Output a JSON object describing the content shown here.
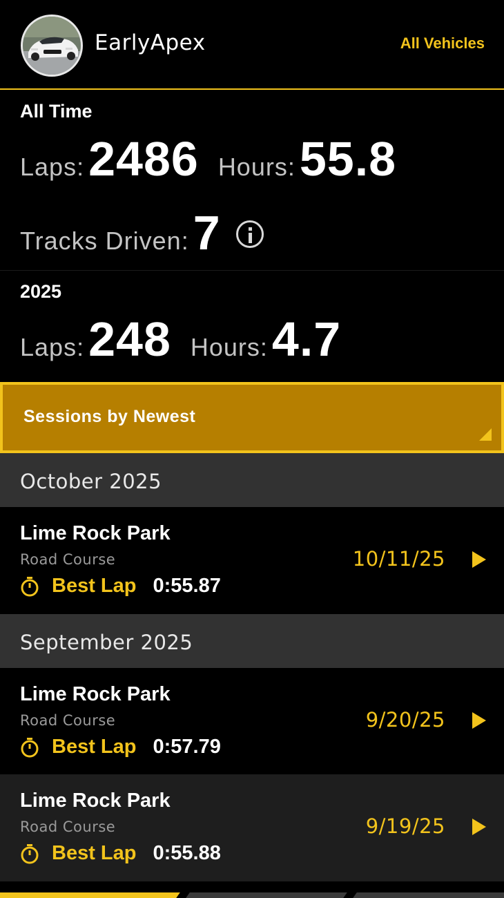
{
  "header": {
    "username": "EarlyApex",
    "all_vehicles_label": "All Vehicles"
  },
  "all_time": {
    "title": "All Time",
    "laps_label": "Laps:",
    "laps_value": "2486",
    "hours_label": "Hours:",
    "hours_value": "55.8",
    "tracks_label": "Tracks Driven:",
    "tracks_value": "7"
  },
  "year": {
    "title": "2025",
    "laps_label": "Laps:",
    "laps_value": "248",
    "hours_label": "Hours:",
    "hours_value": "4.7"
  },
  "sort": {
    "label": "Sessions by Newest"
  },
  "groups": [
    {
      "month": "October 2025",
      "sessions": [
        {
          "track": "Lime Rock Park",
          "config": "Road Course",
          "best_label": "Best Lap",
          "best_time": "0:55.87",
          "date": "10/11/25"
        }
      ]
    },
    {
      "month": "September 2025",
      "sessions": [
        {
          "track": "Lime Rock Park",
          "config": "Road Course",
          "best_label": "Best Lap",
          "best_time": "0:57.79",
          "date": "9/20/25"
        },
        {
          "track": "Lime Rock Park",
          "config": "Road Course",
          "best_label": "Best Lap",
          "best_time": "0:55.88",
          "date": "9/19/25"
        }
      ]
    }
  ],
  "icons": {
    "info": "info-icon",
    "stopwatch": "stopwatch-icon",
    "play": "play-arrow-icon",
    "sort_caret": "dropdown-caret-icon"
  },
  "colors": {
    "accent": "#f2c31c",
    "sort_bar": "#b67f00",
    "month_header": "#323232",
    "background": "#000000"
  }
}
